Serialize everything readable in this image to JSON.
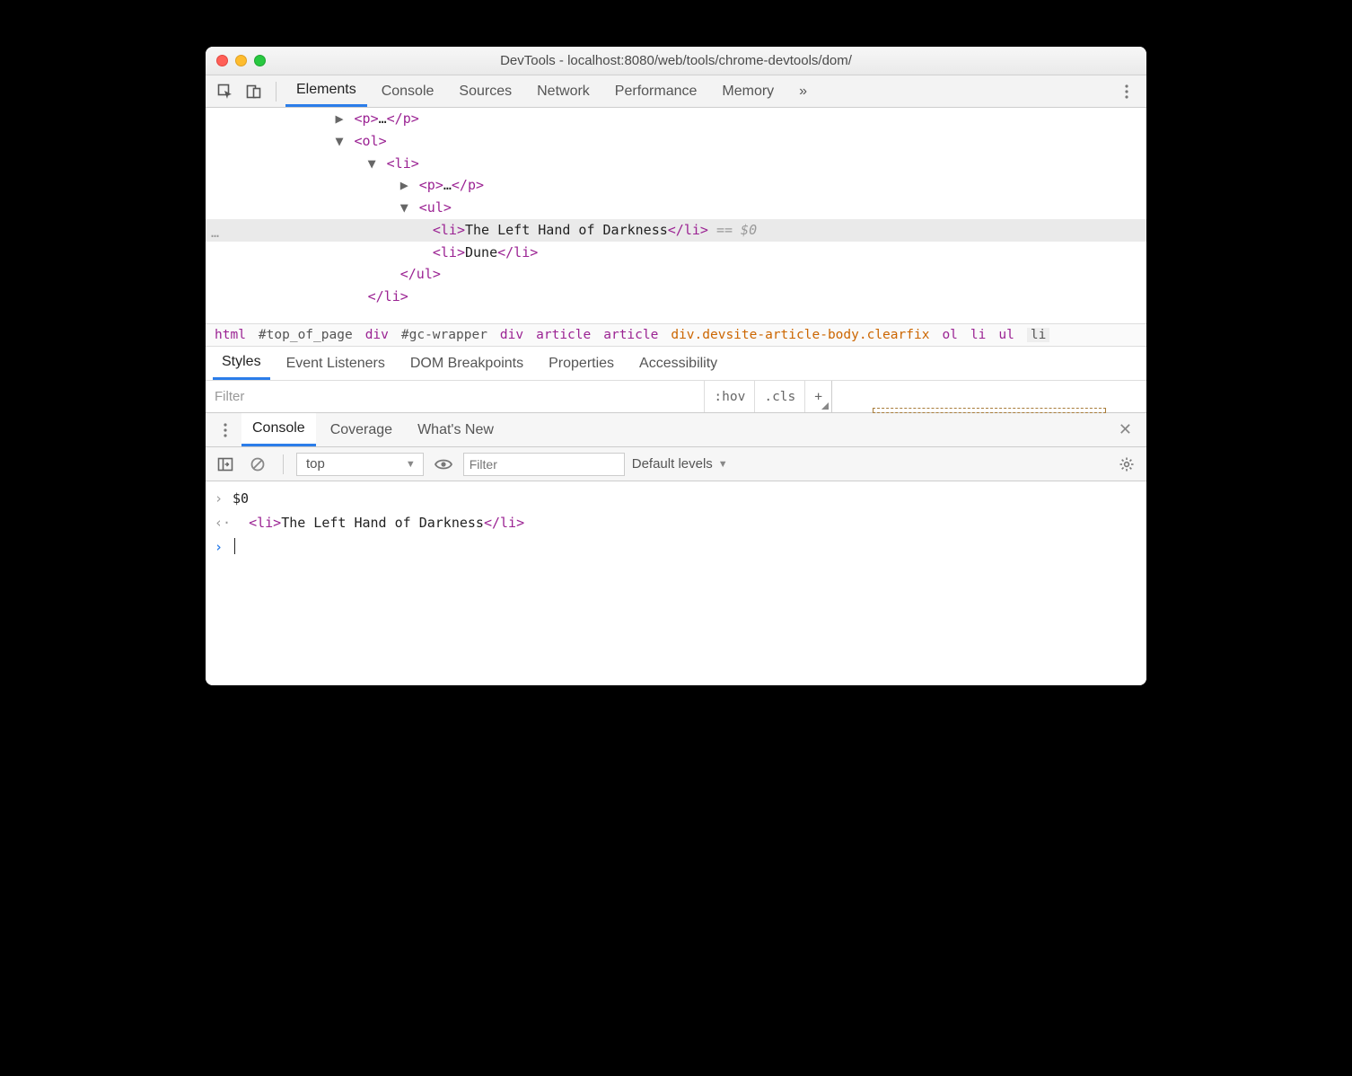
{
  "window": {
    "title": "DevTools - localhost:8080/web/tools/chrome-devtools/dom/"
  },
  "tabs": {
    "main": [
      "Elements",
      "Console",
      "Sources",
      "Network",
      "Performance",
      "Memory"
    ],
    "active": "Elements",
    "more": "»"
  },
  "dom": {
    "lines": [
      {
        "indent": 8,
        "caret": "▶",
        "open": "<p>",
        "text": "…",
        "close": "</p>"
      },
      {
        "indent": 8,
        "caret": "▼",
        "open": "<ol>"
      },
      {
        "indent": 10,
        "caret": "▼",
        "open": "<li>"
      },
      {
        "indent": 12,
        "caret": "▶",
        "open": "<p>",
        "text": "…",
        "close": "</p>"
      },
      {
        "indent": 12,
        "caret": "▼",
        "open": "<ul>"
      },
      {
        "indent": 14,
        "selected": true,
        "open": "<li>",
        "text": "The Left Hand of Darkness",
        "close": "</li>",
        "suffix": " == $0"
      },
      {
        "indent": 14,
        "open": "<li>",
        "text": "Dune",
        "close": "</li>"
      },
      {
        "indent": 12,
        "open": "</ul>"
      },
      {
        "indent": 10,
        "open": "</li>"
      }
    ]
  },
  "crumbs": [
    "html",
    "#top_of_page",
    "div",
    "#gc-wrapper",
    "div",
    "article",
    "article",
    "div.devsite-article-body.clearfix",
    "ol",
    "li",
    "ul",
    "li"
  ],
  "styles": {
    "tabs": [
      "Styles",
      "Event Listeners",
      "DOM Breakpoints",
      "Properties",
      "Accessibility"
    ],
    "active": "Styles",
    "filter_placeholder": "Filter",
    "hov": ":hov",
    "cls": ".cls",
    "plus": "+"
  },
  "drawer": {
    "tabs": [
      "Console",
      "Coverage",
      "What's New"
    ],
    "active": "Console",
    "close": "✕"
  },
  "console_toolbar": {
    "context": "top",
    "filter_placeholder": "Filter",
    "levels": "Default levels"
  },
  "console": {
    "input_echo": "$0",
    "output": {
      "open": "<li>",
      "text": "The Left Hand of Darkness",
      "close": "</li>"
    }
  }
}
